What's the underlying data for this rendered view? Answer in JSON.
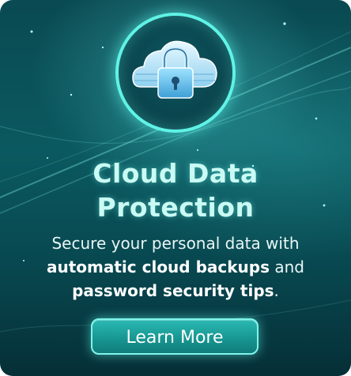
{
  "promo": {
    "title_line1": "Cloud Data",
    "title_line2": "Protection",
    "desc_line1_normal": "Secure your personal data",
    "desc_line1_tail": " with",
    "desc_line2_bold": "automatic cloud backups",
    "desc_line2_tail": " and",
    "desc_line3_bold": "password security tips",
    "desc_line3_tail": ".",
    "cta_label": "Learn More"
  },
  "icons": {
    "hero": "cloud-lock-icon"
  },
  "colors": {
    "background": "#0b5960",
    "accent": "#5ff3e6",
    "title": "#c9fbf4",
    "button": "#189792"
  }
}
